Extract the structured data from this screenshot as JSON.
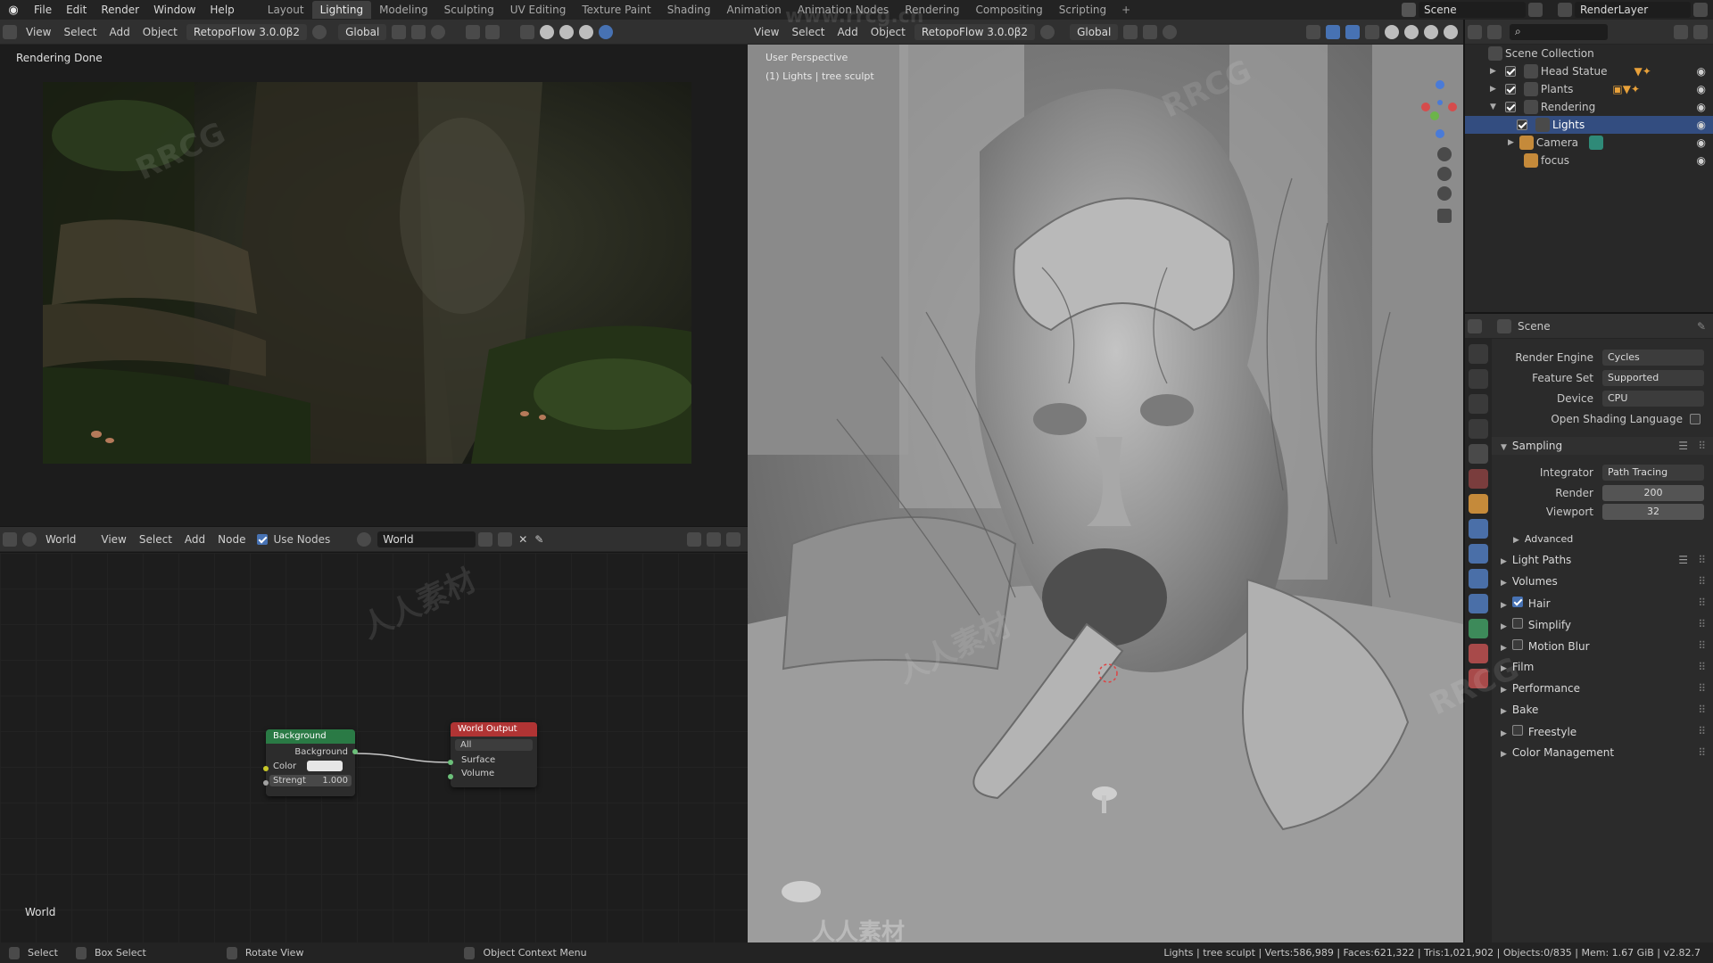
{
  "app": {
    "menus": [
      "File",
      "Edit",
      "Render",
      "Window",
      "Help"
    ],
    "workspaces": [
      "Layout",
      "Lighting",
      "Modeling",
      "Sculpting",
      "UV Editing",
      "Texture Paint",
      "Shading",
      "Animation",
      "Animation Nodes",
      "Rendering",
      "Compositing",
      "Scripting"
    ],
    "active_workspace": "Lighting",
    "scene": "Scene",
    "view_layer": "RenderLayer"
  },
  "image_editor": {
    "header": [
      "View",
      "Select",
      "Add",
      "Object"
    ],
    "addon": "RetopoFlow 3.0.0β2",
    "orientation": "Global",
    "status_text": "Rendering Done"
  },
  "node_editor": {
    "header": [
      "View",
      "Select",
      "Add",
      "Node"
    ],
    "type": "World",
    "use_nodes_label": "Use Nodes",
    "world_name": "World",
    "corner_label": "World",
    "background_node": {
      "title": "Background",
      "output": "Background",
      "color_label": "Color",
      "strength_label": "Strengt",
      "strength_value": "1.000"
    },
    "output_node": {
      "title": "World Output",
      "target": "All",
      "surface": "Surface",
      "volume": "Volume"
    }
  },
  "viewport": {
    "header": [
      "View",
      "Select",
      "Add",
      "Object"
    ],
    "addon": "RetopoFlow 3.0.0β2",
    "orientation": "Global",
    "perspective": "User Perspective",
    "collection_info": "(1) Lights | tree sculpt"
  },
  "outliner": {
    "root": "Scene Collection",
    "items": [
      {
        "name": "Head Statue",
        "checked": true,
        "expanded": false
      },
      {
        "name": "Plants",
        "checked": true,
        "expanded": false
      },
      {
        "name": "Rendering",
        "checked": true,
        "expanded": true
      },
      {
        "name": "Lights",
        "checked": true,
        "selected": true
      },
      {
        "name": "Camera"
      },
      {
        "name": "focus"
      }
    ]
  },
  "properties": {
    "context": "Scene",
    "render_engine_label": "Render Engine",
    "render_engine": "Cycles",
    "feature_set_label": "Feature Set",
    "feature_set": "Supported",
    "device_label": "Device",
    "device": "CPU",
    "osl_label": "Open Shading Language",
    "sampling": "Sampling",
    "integrator_label": "Integrator",
    "integrator": "Path Tracing",
    "render_label": "Render",
    "render_samples": "200",
    "viewport_label": "Viewport",
    "viewport_samples": "32",
    "advanced": "Advanced",
    "panels": [
      "Light Paths",
      "Volumes",
      "Hair",
      "Simplify",
      "Motion Blur",
      "Film",
      "Performance",
      "Bake",
      "Freestyle",
      "Color Management"
    ]
  },
  "statusbar": {
    "select": "Select",
    "box_select": "Box Select",
    "rotate_view": "Rotate View",
    "context_menu": "Object Context Menu",
    "stats": "Lights | tree sculpt | Verts:586,989 | Faces:621,322 | Tris:1,021,902 | Objects:0/835 | Mem: 1.67 GiB | v2.82.7"
  },
  "watermarks": [
    "RRCG",
    "人人素材",
    "www.rrcg.cn"
  ],
  "colors": {
    "accent": "#4772b3",
    "selected_row": "#334d80",
    "node_green": "#2a7a45",
    "node_red": "#b03434"
  }
}
